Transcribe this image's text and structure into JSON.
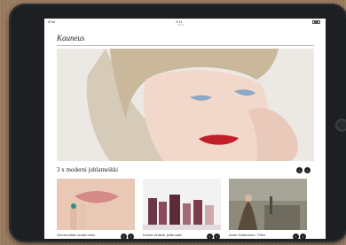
{
  "status": {
    "carrier": "iPad",
    "time": "9.41",
    "url": "a.b.fi"
  },
  "page": {
    "title": "Kauneus"
  },
  "section": {
    "title": "3 x moderni juhlameikki"
  },
  "cards": [
    {
      "caption": "Gomm-iäisin suuta tossi"
    },
    {
      "caption": "Kolme vinkkiä, joilla saat"
    },
    {
      "caption": "Anne Kukkohovi: \"Olen"
    }
  ],
  "icons": {
    "prev": "‹",
    "next": "›"
  }
}
